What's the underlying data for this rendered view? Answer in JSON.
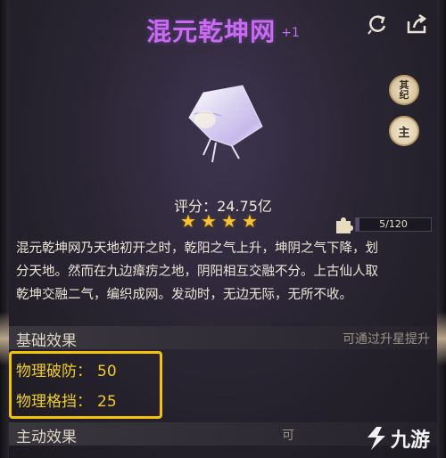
{
  "item": {
    "name": "混元乾坤网",
    "level": "+1",
    "score_label": "评分：24.75亿",
    "star_count": 4,
    "fragment_progress": "5/120",
    "fragment_ratio": 0.0417,
    "description_lines": [
      "混元乾坤网乃天地初开之时，乾阳之气上升，坤阴之气下降，划",
      "分天地。然而在九边瘴疠之地，阴阳相互交融不分。上古仙人取",
      "乾坤交融二气，编织成网。发动时，无边无际，无所不收。"
    ]
  },
  "badges": {
    "qiji": "其纪",
    "zhu": "主"
  },
  "sections": {
    "base": {
      "title": "基础效果",
      "hint": "可通过升星提升"
    },
    "active": {
      "title": "主动效果",
      "hint": "可"
    }
  },
  "stats": {
    "pofang_label": "物理破防：",
    "pofang_value": "50",
    "gedang_label": "物理格挡：",
    "gedang_value": "25"
  },
  "watermark": {
    "text": "九游"
  },
  "colors": {
    "title": "#c86bf0",
    "stat_text": "#f0cc2a",
    "highlight_border": "#f4c20a",
    "star": "#f6c338"
  }
}
